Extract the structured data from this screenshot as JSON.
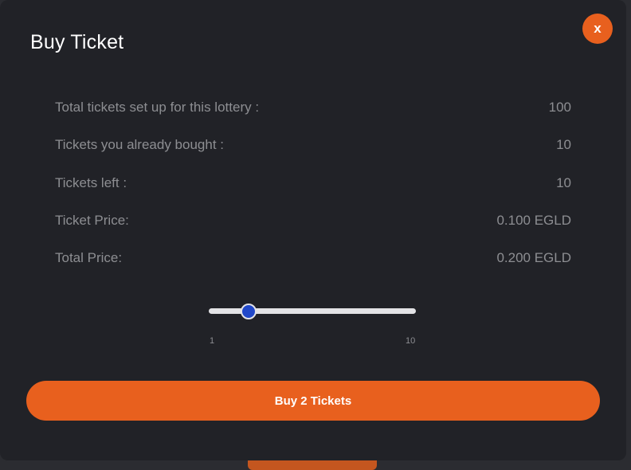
{
  "modal": {
    "title": "Buy Ticket",
    "close_label": "x"
  },
  "info": [
    {
      "label": "Total tickets set up for this lottery :",
      "value": "100"
    },
    {
      "label": "Tickets you already bought :",
      "value": "10"
    },
    {
      "label": "Tickets left :",
      "value": "10"
    },
    {
      "label": "Ticket Price:",
      "value": "0.100 EGLD"
    },
    {
      "label": "Total Price:",
      "value": "0.200 EGLD"
    }
  ],
  "slider": {
    "min_label": "1",
    "max_label": "10",
    "min": 1,
    "max": 10,
    "value": 2
  },
  "buy_button_label": "Buy 2 Tickets",
  "colors": {
    "accent": "#e8601e",
    "slider_thumb": "#2148c9",
    "modal_bg": "#212227"
  }
}
